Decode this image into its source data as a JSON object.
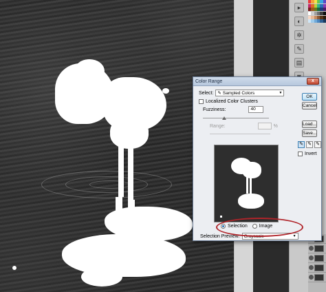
{
  "dialog": {
    "title": "Color Range",
    "select_label": "Select:",
    "select_value": "Sampled Colors",
    "localized_label": "Localized Color Clusters",
    "fuzziness_label": "Fuzziness:",
    "fuzziness_value": "40",
    "range_label": "Range:",
    "range_unit": "%",
    "selection_label": "Selection",
    "image_label": "Image",
    "preview_label": "Selection Preview:",
    "preview_value": "Grayscale",
    "invert_label": "Invert",
    "buttons": {
      "ok": "OK",
      "cancel": "Cancel",
      "load": "Load...",
      "save": "Save..."
    },
    "close_label": "x"
  },
  "tools": [
    {
      "icon": "arrow-tool",
      "glyph": "▸"
    },
    {
      "icon": "eye-tool",
      "glyph": "◐"
    },
    {
      "icon": "gear-tool",
      "glyph": "✲"
    },
    {
      "icon": "brush-tool",
      "glyph": "✎"
    },
    {
      "icon": "layers-tool",
      "glyph": "▤"
    },
    {
      "icon": "mask-tool",
      "glyph": "◙"
    },
    {
      "icon": "text-tool",
      "glyph": "A"
    }
  ],
  "colors": {
    "highlight": "#b0242a",
    "ok_border": "#3c7fb1"
  }
}
